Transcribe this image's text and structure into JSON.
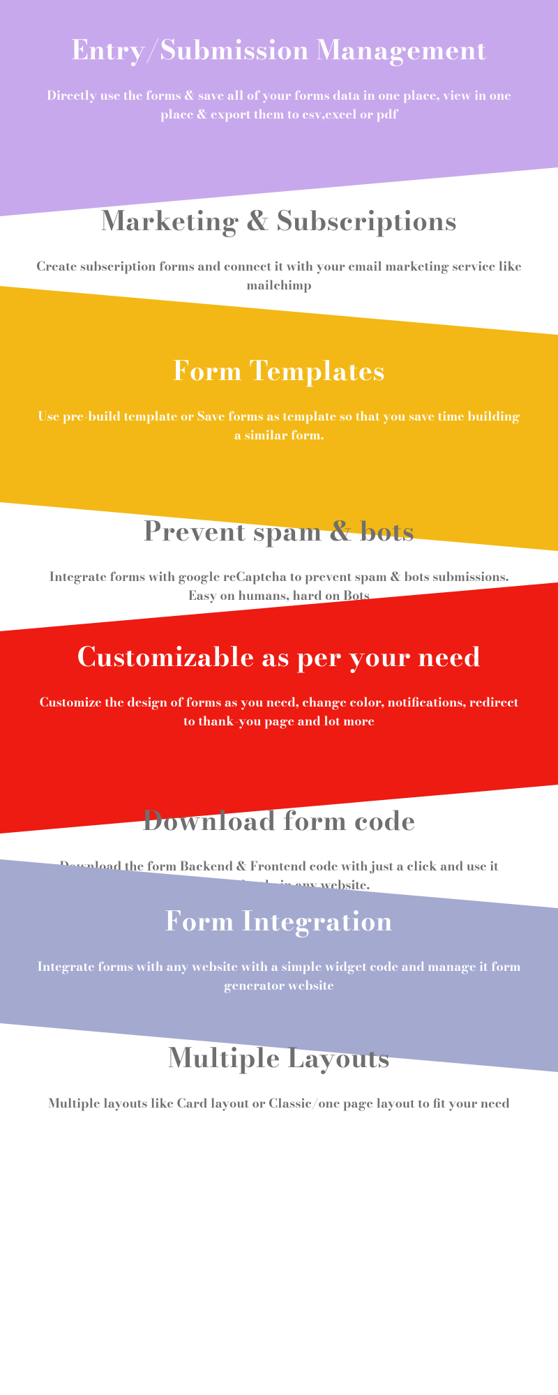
{
  "sections": [
    {
      "title": "Entry/Submission Management",
      "desc": "Directly use the forms & save all of your forms data in one place, view in one place & export them to csv,excel or pdf"
    },
    {
      "title": "Marketing & Subscriptions",
      "desc": "Create subscription forms and connect it with your email marketing service like mailchimp"
    },
    {
      "title": "Form Templates",
      "desc": "Use pre-build template or Save forms as template so that you save time building a similar form."
    },
    {
      "title": "Prevent spam & bots",
      "desc": "Integrate forms with google reCaptcha to prevent spam & bots submissions. Easy on humans, hard on Bots"
    },
    {
      "title": "Customizable as per your need",
      "desc": "Customize the design of forms as you need, change color, notifications, redirect to thank-you page and lot more"
    },
    {
      "title": "Download form code",
      "desc": "Download the form Backend & Frontend code with just a click and use it independently in any website."
    },
    {
      "title": "Form Integration",
      "desc": "Integrate forms with any website with a simple widget code and manage it form generator website"
    },
    {
      "title": "Multiple Layouts",
      "desc": "Multiple layouts like Card layout or Classic/one page layout to fit your need"
    }
  ],
  "colors": {
    "lavender": "#c8a8ec",
    "amber": "#f3b816",
    "red": "#ed1b12",
    "periwinkle": "#a4a9d0",
    "text_muted": "#6f6f6f"
  }
}
